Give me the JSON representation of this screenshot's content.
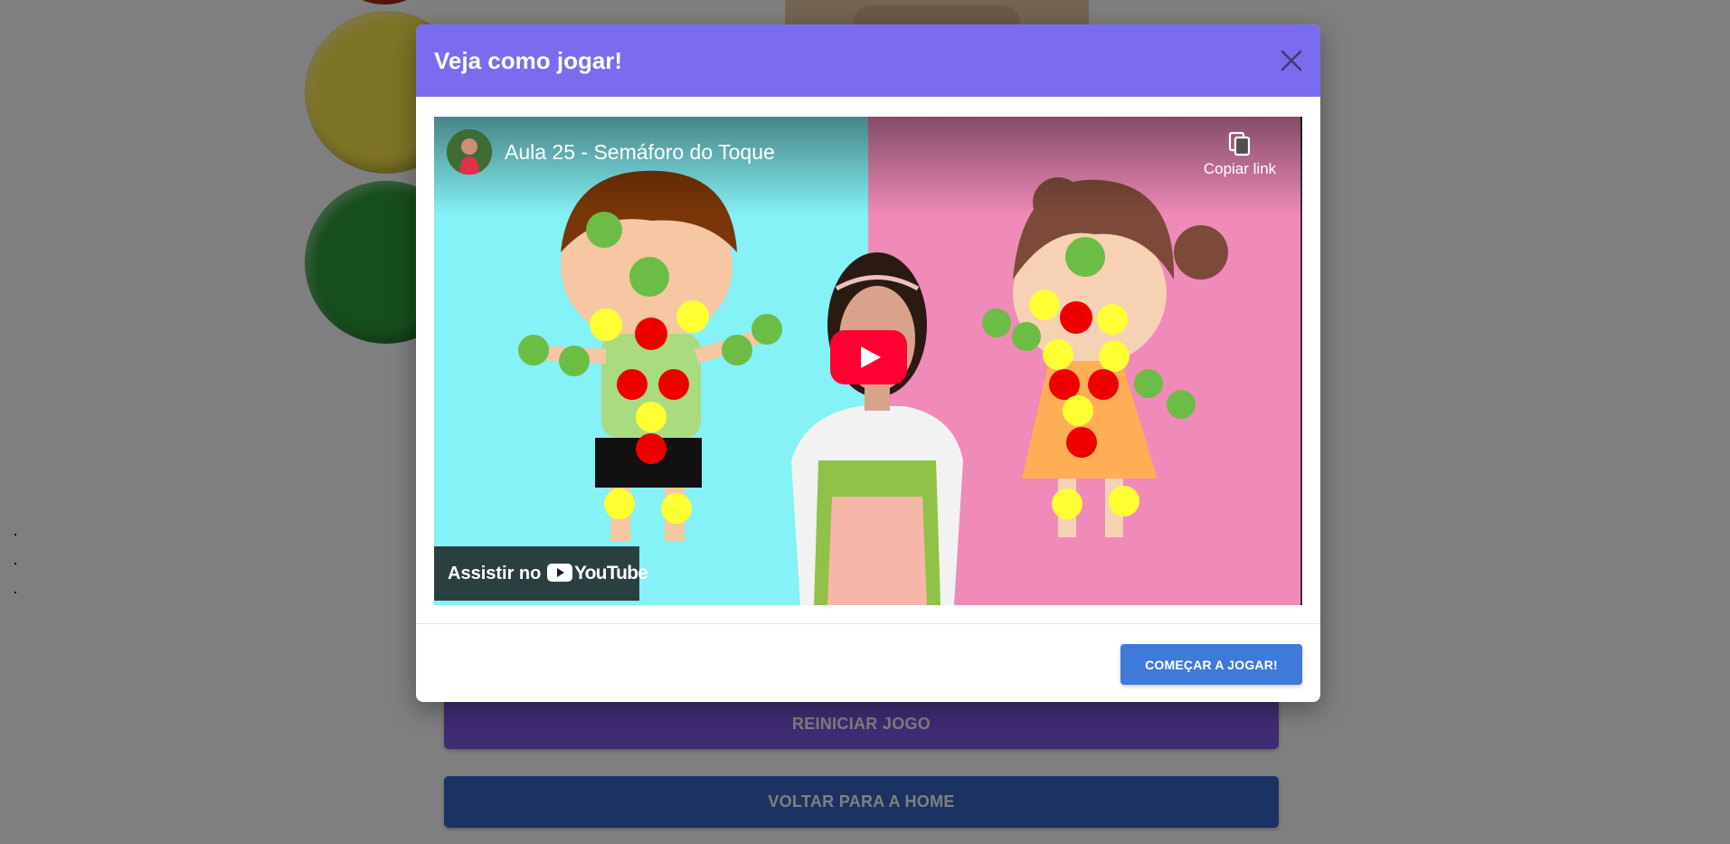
{
  "background": {
    "restart_button_label": "REINICIAR JOGO",
    "home_button_label": "VOLTAR PARA A HOME"
  },
  "modal": {
    "title": "Veja como jogar!",
    "close_icon": "close-icon",
    "video": {
      "title": "Aula 25 - Semáforo do Toque",
      "copy_link_label": "Copiar link",
      "copy_icon": "copy-icon",
      "play_icon": "play-icon",
      "watch_on_label": "Assistir no",
      "youtube_logo_text": "YouTube"
    },
    "start_button_label": "COMEÇAR A JOGAR!"
  },
  "colors": {
    "modal_header": "#7b6bef",
    "start_button": "#3f79d9",
    "restart_button": "#7e58e6",
    "home_button": "#3964c4",
    "youtube_red": "#ff0033"
  }
}
